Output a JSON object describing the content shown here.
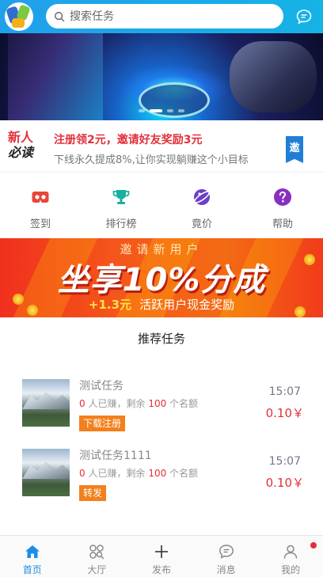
{
  "header": {
    "search_placeholder": "搜索任务"
  },
  "banner": {
    "slide_count": 4,
    "active_slide": 2
  },
  "notice": {
    "badge_line1": "新人",
    "badge_line2": "必读",
    "title": "注册领2元，邀请好友奖励3元",
    "subtitle": "下线永久提成8%,让你实现躺赚这个小目标",
    "invite_label": "邀"
  },
  "quick_nav": [
    {
      "label": "签到",
      "icon": "vr-glasses-icon",
      "color": "#e8463a"
    },
    {
      "label": "排行榜",
      "icon": "trophy-icon",
      "color": "#18b0a0"
    },
    {
      "label": "竟价",
      "icon": "planet-icon",
      "color": "#6a3fc9"
    },
    {
      "label": "帮助",
      "icon": "help-icon",
      "color": "#8a2fc0"
    }
  ],
  "promo": {
    "top": "邀请新用户",
    "main": "坐享10%分成",
    "amount": "+1.3元",
    "desc": "活跃用户现金奖励"
  },
  "section": {
    "title": "推荐任务"
  },
  "tasks": [
    {
      "name": "测试任务",
      "earned": "0",
      "earned_suffix": "人已赚，剩余",
      "remaining": "100",
      "remaining_suffix": "个名额",
      "tag": "下载注册",
      "time": "15:07",
      "price": "0.10￥"
    },
    {
      "name": "测试任务1111",
      "earned": "0",
      "earned_suffix": "人已赚，剩余",
      "remaining": "100",
      "remaining_suffix": "个名额",
      "tag": "转发",
      "time": "15:07",
      "price": "0.10￥"
    }
  ],
  "tabbar": [
    {
      "label": "首页",
      "icon": "home-icon",
      "active": true
    },
    {
      "label": "大厅",
      "icon": "hall-icon",
      "active": false
    },
    {
      "label": "发布",
      "icon": "plus-icon",
      "active": false
    },
    {
      "label": "消息",
      "icon": "message-icon",
      "active": false
    },
    {
      "label": "我的",
      "icon": "user-icon",
      "active": false,
      "badge": true
    }
  ],
  "colors": {
    "primary": "#1c8de6",
    "accent_red": "#e2303a",
    "tag_orange": "#f3801c"
  }
}
